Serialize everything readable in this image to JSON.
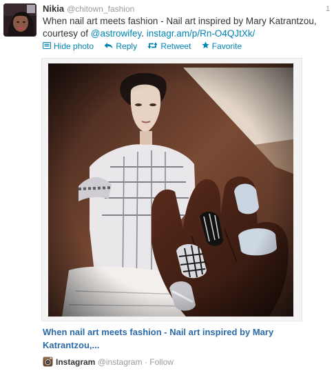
{
  "tweet": {
    "author_name": "Nikia",
    "author_handle": "@chitown_fashion",
    "timestamp": "1",
    "text_before": "When nail art meets fashion - Nail art inspired by Mary Katrantzou, courtesy of ",
    "mention": "@astrowifey",
    "text_between": ". ",
    "link": "instagr.am/p/Rn-O4QJtXk/"
  },
  "actions": {
    "hide_photo": "Hide photo",
    "reply": "Reply",
    "retweet": "Retweet",
    "favorite": "Favorite"
  },
  "media": {
    "link_title": "When nail art meets fashion - Nail art inspired by Mary Katrantzou,...",
    "source_name": "Instagram",
    "source_handle": "@instagram",
    "separator": "·",
    "follow_label": "Follow"
  },
  "colors": {
    "link": "#0084b4",
    "media_title": "#2b6aa8",
    "muted": "#999999"
  },
  "icons": {
    "hide_photo": "photo-icon",
    "reply": "reply-arrow-icon",
    "retweet": "retweet-icon",
    "favorite": "star-icon",
    "source": "instagram-icon"
  }
}
